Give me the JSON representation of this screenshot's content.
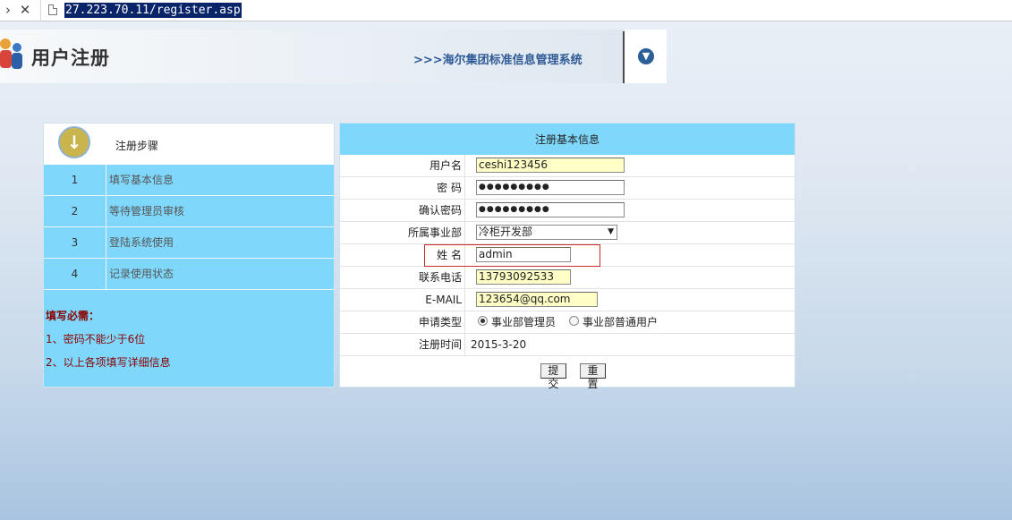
{
  "browser": {
    "url": "27.223.70.11/register.asp"
  },
  "header": {
    "title": "用户注册",
    "system_name": ">>>海尔集团标准信息管理系统"
  },
  "steps": {
    "title": "注册步骤",
    "items": [
      {
        "num": "1",
        "label": "填写基本信息"
      },
      {
        "num": "2",
        "label": "等待管理员审核"
      },
      {
        "num": "3",
        "label": "登陆系统使用"
      },
      {
        "num": "4",
        "label": "记录使用状态"
      }
    ],
    "requirements_title": "填写必需：",
    "requirements": [
      "1、密码不能少于6位",
      "2、以上各项填写详细信息"
    ]
  },
  "form": {
    "title": "注册基本信息",
    "username_label": "用户名",
    "username_value": "ceshi123456",
    "password_label": "密 码",
    "password_value": "●●●●●●●●●",
    "confirm_label": "确认密码",
    "confirm_value": "●●●●●●●●●",
    "department_label": "所属事业部",
    "department_value": "冷柜开发部",
    "name_label": "姓 名",
    "name_value": "admin",
    "phone_label": "联系电话",
    "phone_value": "13793092533",
    "email_label": "E-MAIL",
    "email_value": "123654@qq.com",
    "type_label": "申请类型",
    "type_options": [
      "事业部管理员",
      "事业部普通用户"
    ],
    "type_selected": "事业部管理员",
    "time_label": "注册时间",
    "time_value": "2015-3-20",
    "submit_label": "提交",
    "reset_label": "重置"
  }
}
